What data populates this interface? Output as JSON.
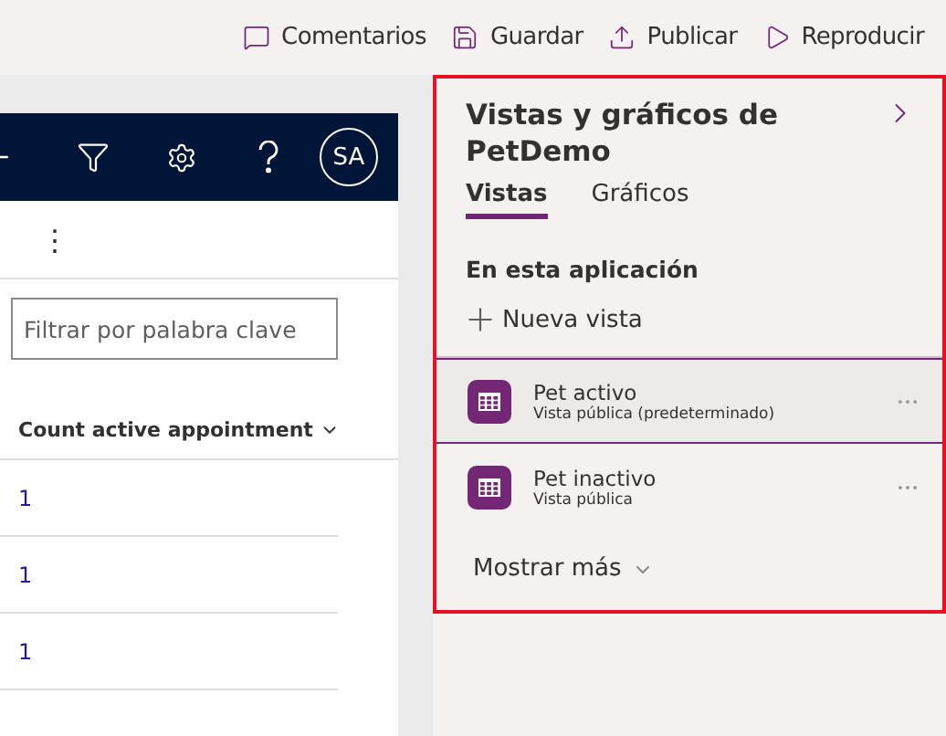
{
  "toolbar": {
    "actions": [
      {
        "kind": "comment",
        "label": "Comentarios"
      },
      {
        "kind": "save",
        "label": "Guardar"
      },
      {
        "kind": "publish",
        "label": "Publicar"
      },
      {
        "kind": "play",
        "label": "Reproducir"
      }
    ]
  },
  "preview": {
    "avatar": "SA",
    "more": "⋮",
    "filter": {
      "placeholder": "Filtrar por palabra clave"
    },
    "column": "Count active appointment",
    "rows": [
      "1",
      "1",
      "1"
    ]
  },
  "panel": {
    "title": "Vistas y gráficos de PetDemo",
    "tabs": [
      {
        "label": "Vistas",
        "selected": true
      },
      {
        "label": "Gráficos",
        "selected": false
      }
    ],
    "section": "En esta aplicación",
    "new_view": "Nueva vista",
    "views": [
      {
        "name": "Pet activo",
        "type": "Vista pública (predeterminado)",
        "selected": true
      },
      {
        "name": "Pet inactivo",
        "type": "Vista pública",
        "selected": false
      }
    ],
    "more": "Mostrar más"
  }
}
